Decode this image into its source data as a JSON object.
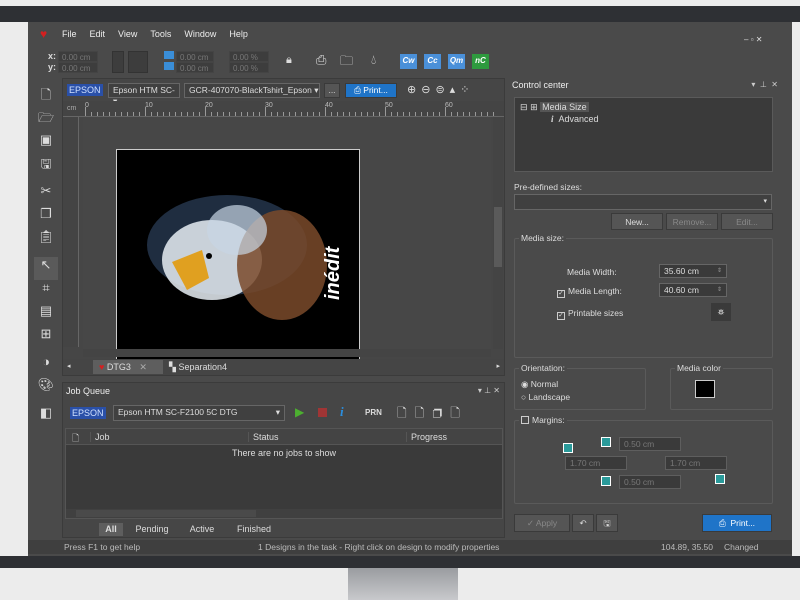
{
  "menu": [
    "File",
    "Edit",
    "View",
    "Tools",
    "Window",
    "Help"
  ],
  "toolbar": {
    "x_label": "x:",
    "y_label": "y:",
    "x_value": "0.00 cm",
    "y_value": "0.00 cm",
    "w_value": "0.00 cm",
    "h_value": "0.00 cm",
    "w_pct": "0.00 %",
    "h_pct": "0.00 %",
    "cw": "Cw",
    "cc": "Cc",
    "qm": "Qm",
    "nc": "nC"
  },
  "doc": {
    "brand": "EPSON",
    "printer": "Epson HTM SC-",
    "profile": "GCR-407070-BlackTshirt_Epson",
    "more": "...",
    "print": "Print...",
    "ruler_unit": "cm",
    "ruler_ticks": [
      "0",
      "10",
      "20",
      "30",
      "40",
      "50",
      "60"
    ],
    "artwork_text": "inédit",
    "tabs": [
      {
        "label": "DTG3",
        "active": true
      },
      {
        "label": "Separation4",
        "active": false
      }
    ]
  },
  "job_queue": {
    "title": "Job Queue",
    "brand": "EPSON",
    "printer": "Epson HTM SC-F2100 5C DTG",
    "prn": "PRN",
    "columns": [
      "Job",
      "Status",
      "Progress"
    ],
    "empty": "There are no jobs to show",
    "tabs": [
      "All",
      "Pending",
      "Active",
      "Finished"
    ]
  },
  "control": {
    "title": "Control center",
    "tree": [
      "Media Size",
      "Advanced"
    ],
    "predefined_label": "Pre-defined sizes:",
    "predefined_value": "",
    "new": "New...",
    "remove": "Remove...",
    "edit": "Edit...",
    "media_size_label": "Media size:",
    "width_label": "Media Width:",
    "width_value": "35.60 cm",
    "length_label": "Media Length:",
    "length_value": "40.60 cm",
    "length_checked": true,
    "printable_label": "Printable sizes",
    "printable_checked": true,
    "orientation_label": "Orientation:",
    "normal": "Normal",
    "landscape": "Landscape",
    "orientation_selected": "Normal",
    "media_color_label": "Media color",
    "media_color": "#000000",
    "margins_label": "Margins:",
    "margins_checked": false,
    "margin_top": "0.50 cm",
    "margin_left": "1.70 cm",
    "margin_right": "1.70 cm",
    "margin_bottom": "0.50 cm",
    "apply": "Apply",
    "print": "Print..."
  },
  "status": {
    "help": "Press F1 to get help",
    "info": "1 Designs in the task - Right click on design to modify properties",
    "coords": "104.89, 35.50",
    "state": "Changed"
  },
  "colors": {
    "accent": "#1f74c8",
    "brand_red": "#d42020",
    "background": "#4a4a4a"
  }
}
